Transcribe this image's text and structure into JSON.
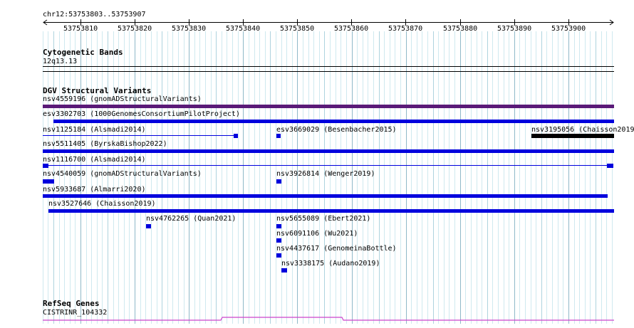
{
  "ruler": {
    "location": "chr12:53753803..53753907",
    "ticks": [
      "53753810",
      "53753820",
      "53753830",
      "53753840",
      "53753850",
      "53753860",
      "53753870",
      "53753880",
      "53753890",
      "53753900"
    ]
  },
  "tracks": {
    "cytoband": {
      "title": "Cytogenetic Bands",
      "band": "12q13.13"
    },
    "dgv": {
      "title": "DGV Structural Variants",
      "colors": {
        "primary": "#0000dd",
        "gnomad": "#5a1a78",
        "chaisson_black": "#000000"
      },
      "features": [
        {
          "id": "nsv4559196",
          "label": "nsv4559196 (gnomADStructuralVariants)"
        },
        {
          "id": "esv3302703",
          "label": "esv3302703 (1000GenomesConsortiumPilotProject)"
        },
        {
          "id": "nsv1125184",
          "label": "nsv1125184 (Alsmadi2014)"
        },
        {
          "id": "esv3669029",
          "label": "esv3669029 (Besenbacher2015)"
        },
        {
          "id": "nsv3195056",
          "label": "nsv3195056 (Chaisson2019"
        },
        {
          "id": "nsv5511405",
          "label": "nsv5511405 (ByrskaBishop2022)"
        },
        {
          "id": "nsv1116700",
          "label": "nsv1116700 (Alsmadi2014)"
        },
        {
          "id": "nsv4540059",
          "label": "nsv4540059 (gnomADStructuralVariants)"
        },
        {
          "id": "nsv3926814",
          "label": "nsv3926814 (Wenger2019)"
        },
        {
          "id": "nsv5933687",
          "label": "nsv5933687 (Almarri2020)"
        },
        {
          "id": "nsv3527646",
          "label": "nsv3527646 (Chaisson2019)"
        },
        {
          "id": "nsv4762265",
          "label": "nsv4762265 (Quan2021)"
        },
        {
          "id": "nsv5655089",
          "label": "nsv5655089 (Ebert2021)"
        },
        {
          "id": "nsv6091106",
          "label": "nsv6091106 (Wu2021)"
        },
        {
          "id": "nsv4437617",
          "label": "nsv4437617 (GenomeinaBottle)"
        },
        {
          "id": "nsv3338175",
          "label": "nsv3338175 (Audano2019)"
        }
      ]
    },
    "refseq": {
      "title": "RefSeq Genes",
      "gene": "CISTRINR_104332",
      "color": "#cc44cc"
    }
  }
}
